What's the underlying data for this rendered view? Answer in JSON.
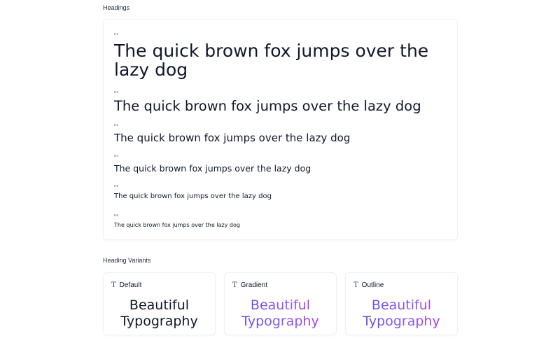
{
  "sections": {
    "headings_title": "Headings",
    "variants_title": "Heading Variants"
  },
  "headings": [
    {
      "level": "H1",
      "text": "The quick brown fox jumps over the lazy dog"
    },
    {
      "level": "H2",
      "text": "The quick brown fox jumps over the lazy dog"
    },
    {
      "level": "H3",
      "text": "The quick brown fox jumps over the lazy dog"
    },
    {
      "level": "H4",
      "text": "The quick brown fox jumps over the lazy dog"
    },
    {
      "level": "H5",
      "text": "The quick brown fox jumps over the lazy dog"
    },
    {
      "level": "H6",
      "text": "The quick brown fox jumps over the lazy dog"
    }
  ],
  "variants": [
    {
      "icon": "T",
      "label": "Default",
      "line1": "Beautiful",
      "line2": "Typography"
    },
    {
      "icon": "T",
      "label": "Gradient",
      "line1": "Beautiful",
      "line2": "Typography"
    },
    {
      "icon": "T",
      "label": "Outline",
      "line1": "Beautiful",
      "line2": "Typography"
    }
  ],
  "colors": {
    "text": "#0f172a",
    "gradient_start": "#4f46e5",
    "gradient_mid": "#8b5cf6",
    "gradient_end": "#c026d3"
  },
  "icons": {
    "variant_icon": "type-icon"
  }
}
